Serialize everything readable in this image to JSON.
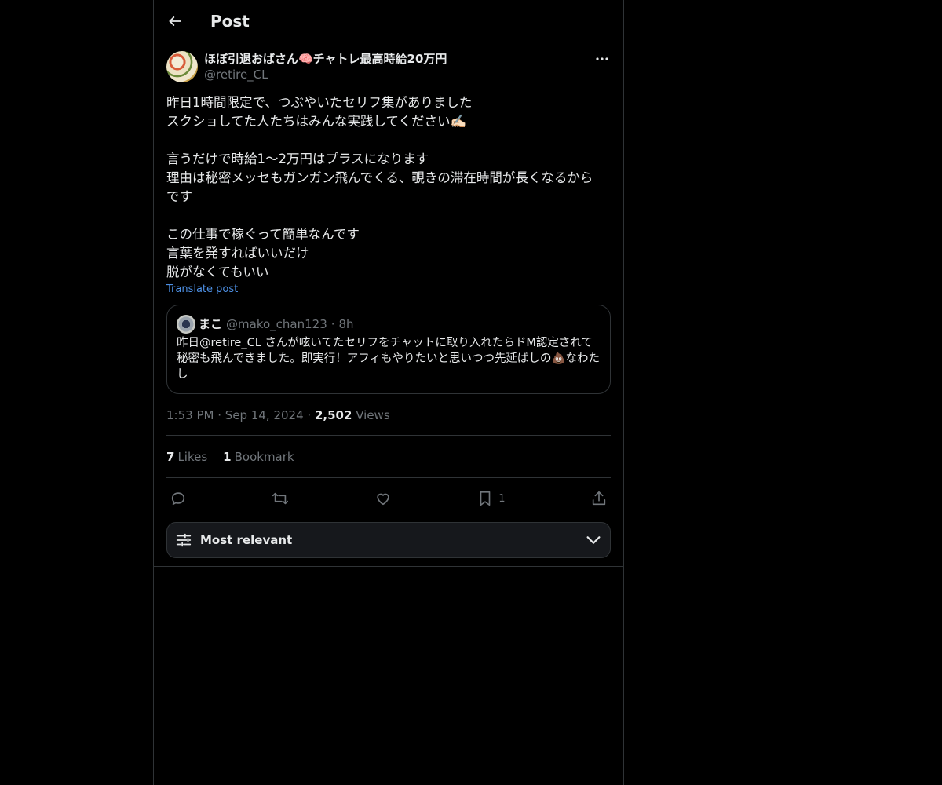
{
  "header": {
    "title": "Post",
    "back_icon": "arrow-left-icon"
  },
  "post": {
    "author": {
      "display_name": "ほぼ引退おばさん🧠チャトレ最高時給20万円",
      "handle": "@retire_CL"
    },
    "more_icon": "more-horizontal-icon",
    "text": "昨日1時間限定で、つぶやいたセリフ集がありました\nスクショしてた人たちはみんな実践してください✍🏻\n\n言うだけで時給1〜2万円はプラスになります\n理由は秘密メッセもガンガン飛んでくる、覗きの滞在時間が長くなるから\nです\n\nこの仕事で稼ぐって簡単なんです\n言葉を発すればいいだけ\n脱がなくてもいい",
    "translate_label": "Translate post",
    "quote": {
      "name": "まこ",
      "handle": "@mako_chan123",
      "separator": "·",
      "time": "8h",
      "text": "昨日@retire_CL さんが呟いてたセリフをチャットに取り入れたらドM認定されて秘密も飛んできました。即実行！アフィもやりたいと思いつつ先延ばしの💩なわたし"
    },
    "meta": {
      "time": "1:53 PM",
      "separator": "·",
      "date": "Sep 14, 2024",
      "views_count": "2,502",
      "views_label": "Views"
    },
    "stats": {
      "likes_count": "7",
      "likes_label": "Likes",
      "bookmarks_count": "1",
      "bookmarks_label": "Bookmark"
    },
    "actions": {
      "reply_icon": "reply-icon",
      "repost_icon": "repost-icon",
      "like_icon": "heart-icon",
      "bookmark_icon": "bookmark-icon",
      "bookmark_count": "1",
      "share_icon": "share-icon"
    },
    "sort": {
      "label": "Most relevant",
      "icon": "sliders-icon",
      "chevron": "chevron-down-icon"
    }
  },
  "colors": {
    "background": "#000000",
    "text": "#e7e9ea",
    "muted": "#71767b",
    "link": "#4d8fe3",
    "border": "#2f3336"
  }
}
